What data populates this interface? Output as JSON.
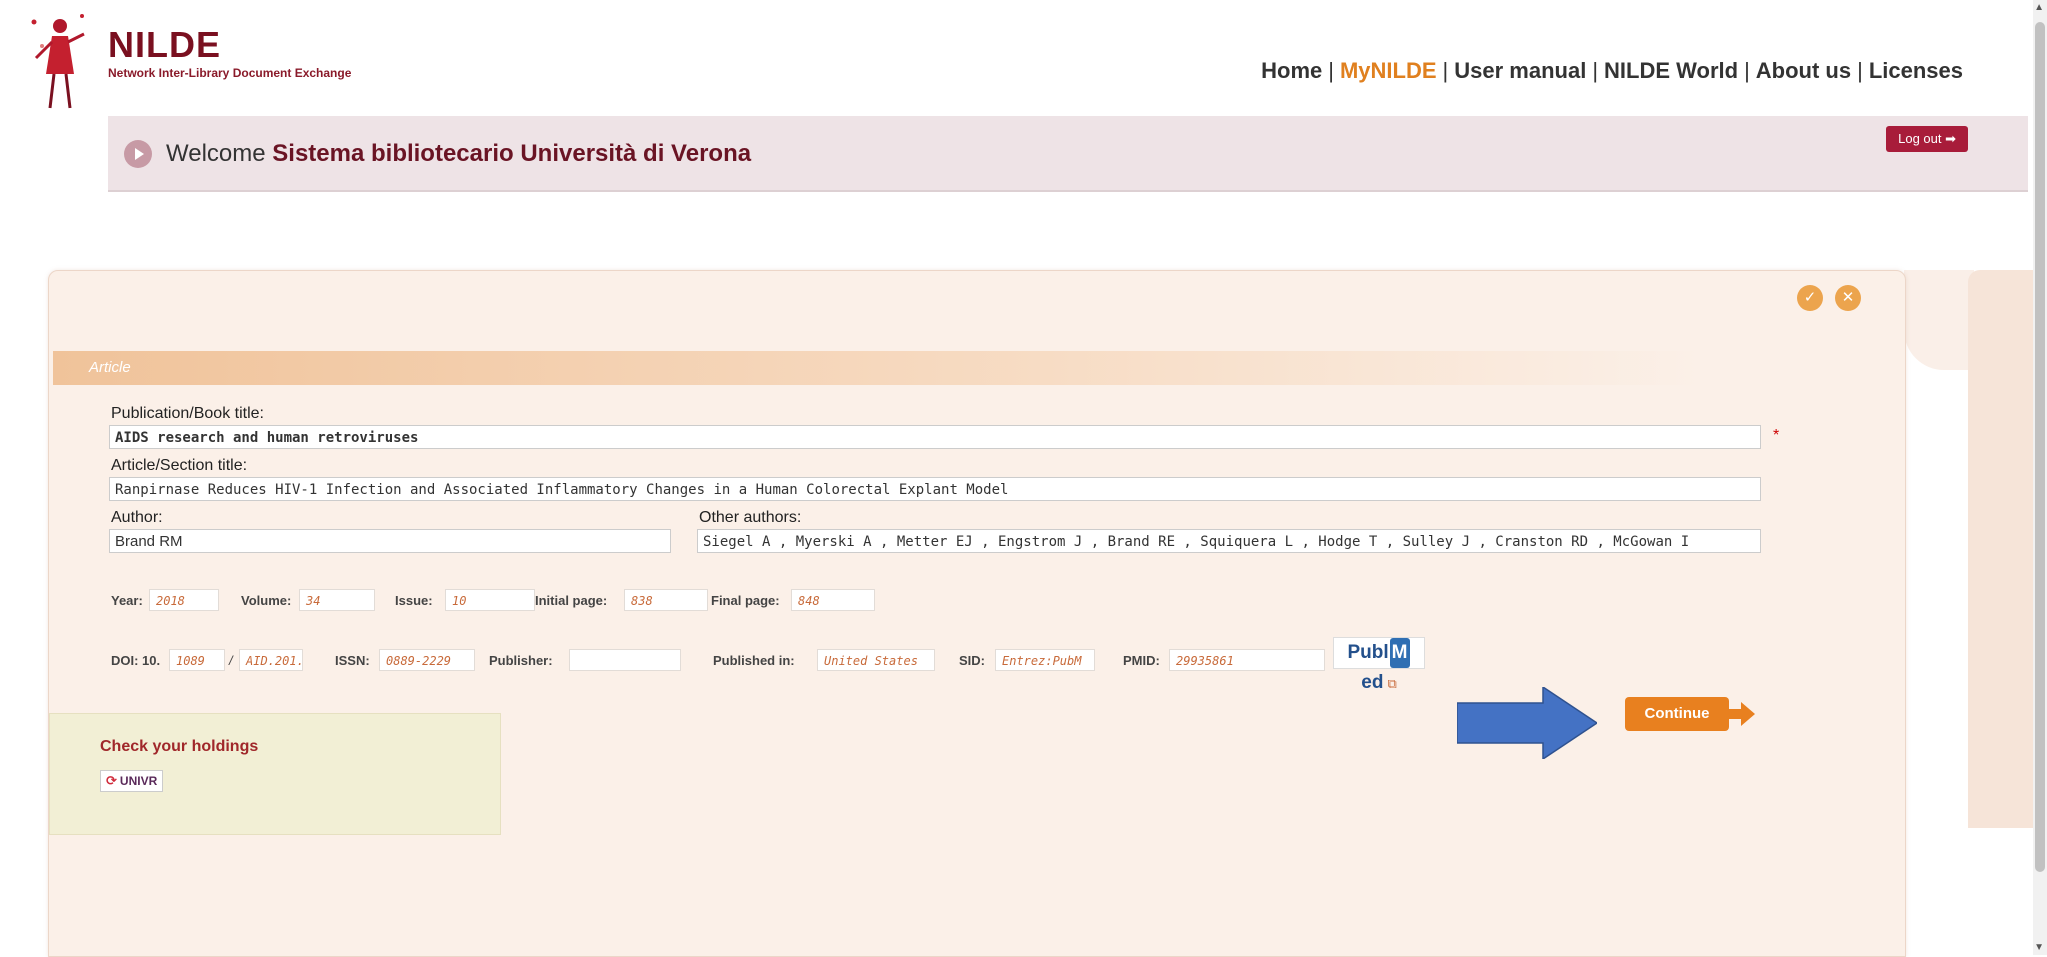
{
  "header": {
    "logo_title": "NILDE",
    "logo_subtitle": "Network Inter-Library Document Exchange",
    "nav": [
      "Home",
      "MyNILDE",
      "User manual",
      "NILDE World",
      "About us",
      "Licenses"
    ],
    "active_nav": "MyNILDE",
    "welcome_prefix": "Welcome",
    "welcome_name": "Sistema bibliotecario Università di Verona",
    "logout_label": "Log out ➡"
  },
  "panel": {
    "section_label": "Article",
    "publication_title_label": "Publication/Book title:",
    "publication_title_value": "AIDS research and human retroviruses",
    "required_mark": "*",
    "article_title_label": "Article/Section title:",
    "article_title_value": "Ranpirnase Reduces HIV-1 Infection and Associated Inflammatory Changes in a Human Colorectal Explant Model",
    "author_label": "Author:",
    "author_value": "Brand RM",
    "other_authors_label": "Other authors:",
    "other_authors_value": "Siegel A , Myerski A , Metter EJ , Engstrom J , Brand RE , Squiquera L , Hodge T , Sulley J , Cranston RD , McGowan I",
    "year_label": "Year:",
    "year_value": "2018",
    "volume_label": "Volume:",
    "volume_value": "34",
    "issue_label": "Issue:",
    "issue_value": "10",
    "initial_page_label": "Initial page:",
    "initial_page_value": "838",
    "final_page_label": "Final page:",
    "final_page_value": "848",
    "doi_label": "DOI: 10.",
    "doi_prefix_value": "1089",
    "doi_sep": "/",
    "doi_suffix_value": "AID.201.",
    "issn_label": "ISSN:",
    "issn_value": "0889-2229",
    "publisher_label": "Publisher:",
    "publisher_value": "",
    "published_in_label": "Published in:",
    "published_in_value": "United States",
    "sid_label": "SID:",
    "sid_value": "Entrez:PubM",
    "pmid_label": "PMID:",
    "pmid_value": "29935861",
    "pubmed_pre": "Publ",
    "pubmed_m": "M",
    "pubmed_post": "ed",
    "holdings_title": "Check your holdings",
    "univr_label": "UNIVR",
    "continue_label": "Continue"
  },
  "colors": {
    "brand": "#7a1020",
    "accent_orange": "#e8801f",
    "logout_red": "#a81c3a",
    "panel_bg": "#fbf0e8",
    "arrow_blue": "#4472c4"
  },
  "icons": {
    "confirm": "check-circle-icon",
    "cancel": "close-circle-icon",
    "welcome": "play-circle-icon",
    "external": "external-link-icon"
  }
}
